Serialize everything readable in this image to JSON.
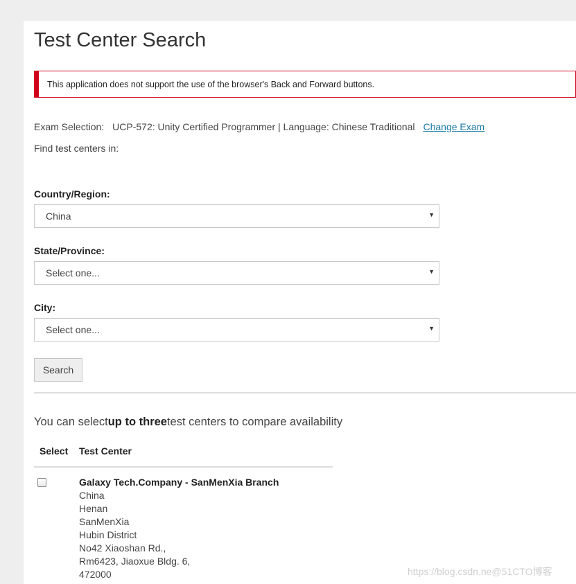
{
  "page": {
    "title": "Test Center Search"
  },
  "alert": {
    "message": "This application does not support the use of the browser's Back and Forward buttons.",
    "color": "#d0021b"
  },
  "exam": {
    "label": "Exam Selection:",
    "value": "UCP-572: Unity Certified Programmer | Language: Chinese Traditional",
    "change_link": "Change Exam"
  },
  "find_label": "Find test centers in:",
  "filters": {
    "country": {
      "label": "Country/Region:",
      "value": "China"
    },
    "state": {
      "label": "State/Province:",
      "value": "Select one..."
    },
    "city": {
      "label": "City:",
      "value": "Select one..."
    }
  },
  "search_button": "Search",
  "compare": {
    "prefix": "You can select",
    "emphasis": "up to three",
    "suffix": "test centers to compare availability"
  },
  "table": {
    "headers": [
      "Select",
      "Test Center"
    ],
    "rows": [
      {
        "name": "Galaxy Tech.Company - SanMenXia Branch",
        "address": [
          "China",
          "Henan",
          "SanMenXia",
          "Hubin District",
          "No42 Xiaoshan Rd.,",
          "Rm6423, Jiaoxue Bldg. 6,",
          "472000"
        ],
        "checked": false
      }
    ]
  },
  "watermark": "https://blog.csdn.ne@51CTO博客",
  "colors": {
    "link": "#1a7aa8",
    "background": "#eeeeee",
    "card": "#ffffff"
  }
}
